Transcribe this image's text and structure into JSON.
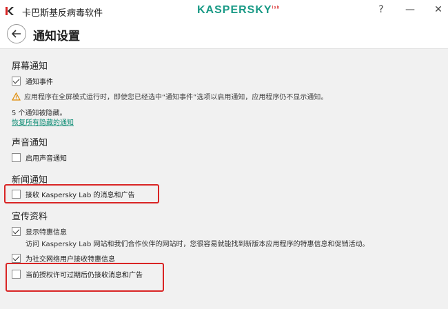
{
  "window": {
    "app_title": "卡巴斯基反病毒软件",
    "brand": "KASPERSKY",
    "brand_sup": "lab",
    "help_label": "?",
    "minimize_label": "—",
    "close_label": "✕"
  },
  "header": {
    "page_title": "通知设置"
  },
  "screen": {
    "title": "屏幕通知",
    "notify_events": {
      "label": "通知事件",
      "checked": true
    },
    "warning": "应用程序在全屏模式运行时，即使您已经选中“通知事件”选项以启用通知，应用程序仍不显示通知。",
    "hidden_count": "5 个通知被隐藏。",
    "restore_link": "恢复所有隐藏的通知"
  },
  "sound": {
    "title": "声音通知",
    "enable_sound": {
      "label": "启用声音通知",
      "checked": false
    }
  },
  "news": {
    "title": "新闻通知",
    "receive_news": {
      "label": "接收 Kaspersky Lab 的消息和广告",
      "checked": false
    }
  },
  "promo": {
    "title": "宣传资料",
    "show_offers": {
      "label": "显示特惠信息",
      "checked": true
    },
    "offers_desc": "访问 Kaspersky Lab 网站和我们合作伙伴的网站时，您很容易就能找到新版本应用程序的特惠信息和促销活动。",
    "social_offers": {
      "label": "为社交网络用户接收特惠信息",
      "checked": true
    },
    "after_expiry": {
      "label": "当前授权许可过期后仍接收消息和广告",
      "checked": false
    }
  },
  "colors": {
    "accent": "#1a9a86",
    "link": "#0d8c74",
    "highlight": "#d92424",
    "content_bg": "#f1f1f1"
  }
}
